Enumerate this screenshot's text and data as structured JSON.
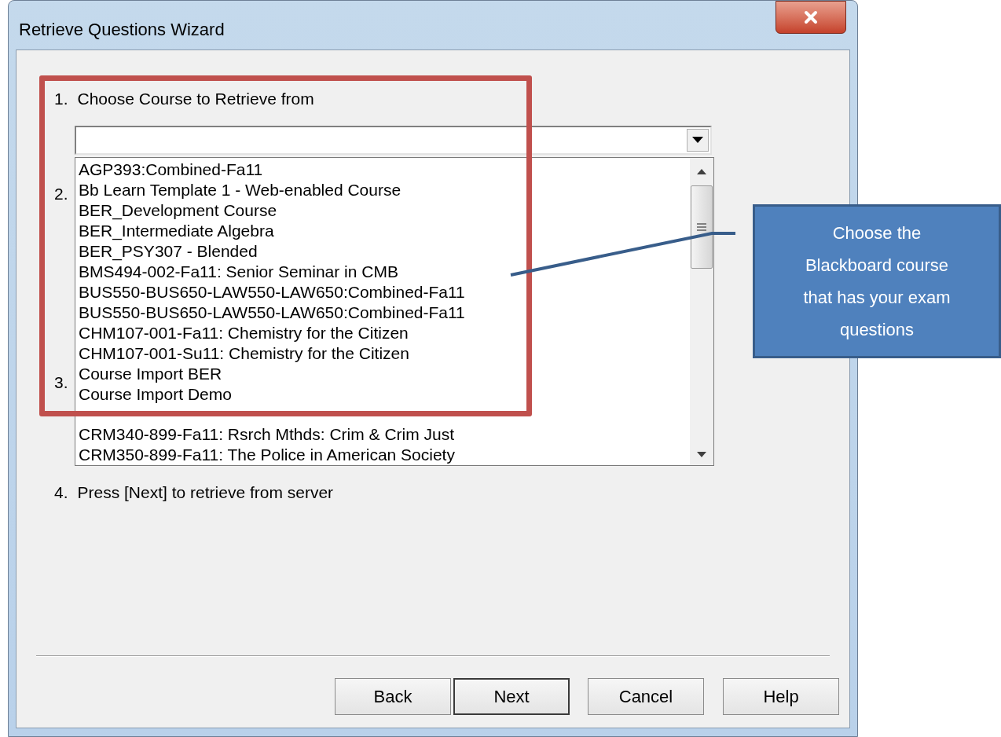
{
  "window": {
    "title": "Retrieve Questions Wizard"
  },
  "steps": [
    {
      "number": "1.",
      "label": "Choose Course to Retrieve from"
    },
    {
      "number": "2."
    },
    {
      "number": "3."
    },
    {
      "number": "4.",
      "label": "Press [Next] to retrieve from server"
    }
  ],
  "course_list": [
    {
      "kind": "item",
      "label": "AGP393:Combined-Fa11"
    },
    {
      "kind": "item",
      "label": "Bb Learn Template 1 - Web-enabled Course"
    },
    {
      "kind": "item",
      "label": "BER_Development Course"
    },
    {
      "kind": "item",
      "label": "BER_Intermediate Algebra"
    },
    {
      "kind": "item",
      "label": "BER_PSY307 - Blended"
    },
    {
      "kind": "item",
      "label": "BMS494-002-Fa11: Senior Seminar in CMB"
    },
    {
      "kind": "item",
      "label": "BUS550-BUS650-LAW550-LAW650:Combined-Fa11"
    },
    {
      "kind": "item",
      "label": "BUS550-BUS650-LAW550-LAW650:Combined-Fa11"
    },
    {
      "kind": "item",
      "label": "CHM107-001-Fa11: Chemistry for the Citizen"
    },
    {
      "kind": "item",
      "label": "CHM107-001-Su11: Chemistry for the Citizen"
    },
    {
      "kind": "item",
      "label": "Course Import BER"
    },
    {
      "kind": "item",
      "label": "Course Import Demo"
    },
    {
      "kind": "covered"
    },
    {
      "kind": "item",
      "label": "CRM340-899-Fa11: Rsrch Mthds: Crim & Crim Just"
    },
    {
      "kind": "item",
      "label": "CRM350-899-Fa11: The Police in American Society"
    }
  ],
  "buttons": [
    {
      "label": "Back",
      "default": false
    },
    {
      "label": "Next",
      "default": true
    },
    {
      "label": "Cancel",
      "default": false
    },
    {
      "label": "Help",
      "default": false
    }
  ],
  "callout": {
    "text": "Choose the Blackboard course that has your exam questions"
  }
}
